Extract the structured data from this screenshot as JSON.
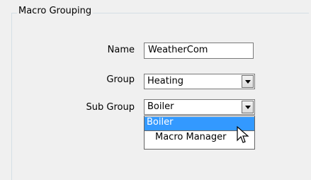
{
  "groupbox": {
    "title": "Macro Grouping"
  },
  "form": {
    "name_label": "Name",
    "name_value": "WeatherCom",
    "group_label": "Group",
    "group_value": "Heating",
    "subgroup_label": "Sub Group",
    "subgroup_value": "Boiler"
  },
  "dropdown": {
    "options": [
      "Boiler",
      "Macro Manager"
    ],
    "selected": "Boiler"
  },
  "colors": {
    "highlight": "#3399ff",
    "background": "#f0f0f0"
  },
  "icons": {
    "combo_button": "chevron-down-icon",
    "cursor": "mouse-pointer-icon"
  }
}
